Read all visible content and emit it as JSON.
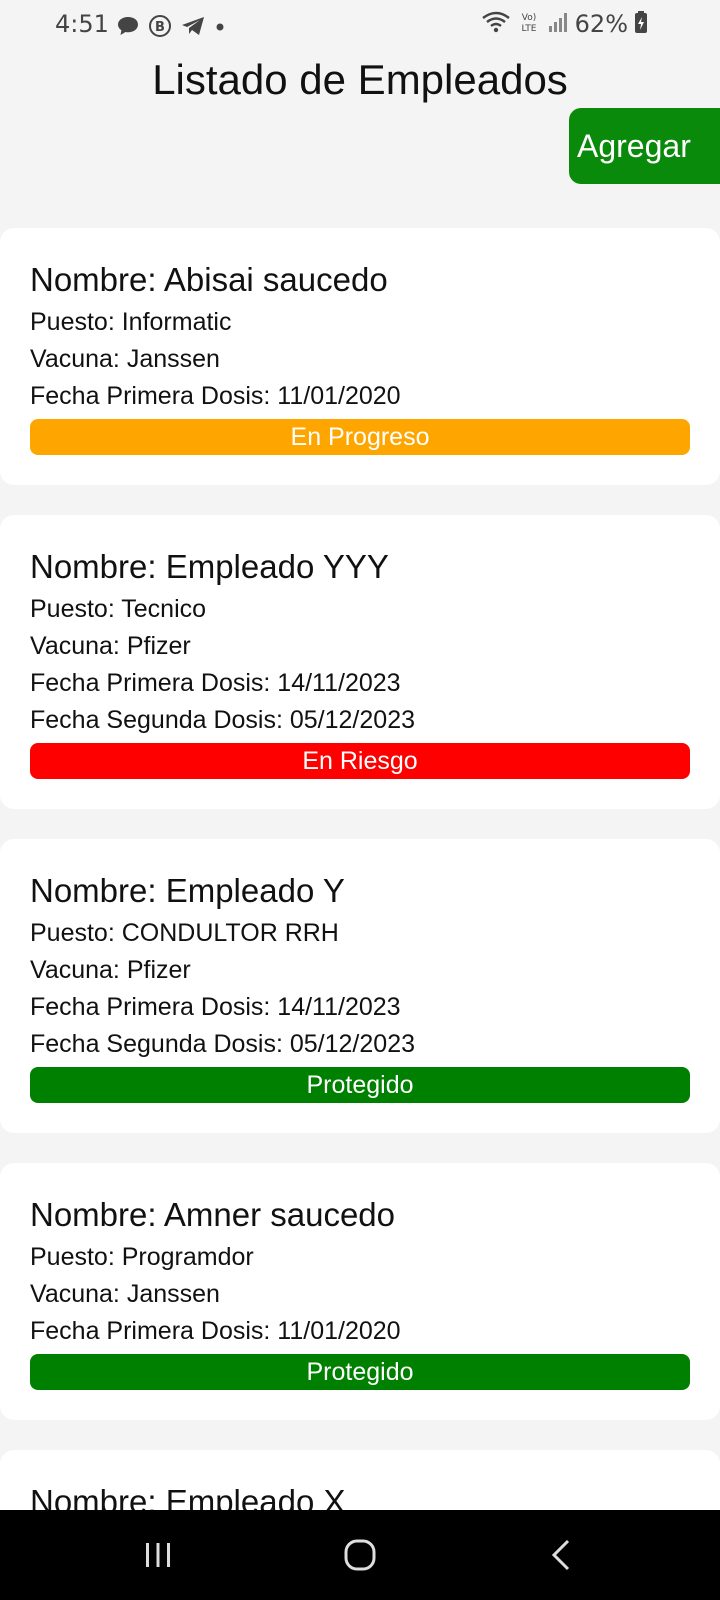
{
  "status_bar": {
    "time": "4:51",
    "battery": "62%",
    "icons": [
      "chat-bubble-icon",
      "b-circle-icon",
      "telegram-icon",
      "dot-icon",
      "wifi-icon",
      "volte-icon",
      "signal-icon",
      "battery-icon"
    ]
  },
  "header": {
    "title": "Listado de Empleados",
    "add_label": "Agregar",
    "add_color": "#0a8a0a"
  },
  "employees": [
    {
      "name": "Nombre: Abisai saucedo",
      "puesto": "Puesto: Informatic",
      "vacuna": "Vacuna: Janssen",
      "dosis1": "Fecha Primera Dosis: 11/01/2020",
      "dosis2": "",
      "status": "En Progreso",
      "status_color": "#ffa500"
    },
    {
      "name": "Nombre: Empleado YYY",
      "puesto": "Puesto: Tecnico",
      "vacuna": "Vacuna: Pfizer",
      "dosis1": "Fecha Primera Dosis: 14/11/2023",
      "dosis2": "Fecha Segunda Dosis: 05/12/2023",
      "status": "En Riesgo",
      "status_color": "#ff0000"
    },
    {
      "name": "Nombre: Empleado Y",
      "puesto": "Puesto: CONDULTOR RRH",
      "vacuna": "Vacuna: Pfizer",
      "dosis1": "Fecha Primera Dosis: 14/11/2023",
      "dosis2": "Fecha Segunda Dosis: 05/12/2023",
      "status": "Protegido",
      "status_color": "#008000"
    },
    {
      "name": "Nombre: Amner saucedo",
      "puesto": "Puesto: Programdor",
      "vacuna": "Vacuna: Janssen",
      "dosis1": "Fecha Primera Dosis: 11/01/2020",
      "dosis2": "",
      "status": "Protegido",
      "status_color": "#008000"
    },
    {
      "name": "Nombre: Empleado X",
      "puesto": "",
      "vacuna": "",
      "dosis1": "",
      "dosis2": "",
      "status": "",
      "status_color": ""
    }
  ],
  "nav_bar": {
    "buttons": [
      "recent-apps-icon",
      "home-icon",
      "back-icon"
    ]
  }
}
